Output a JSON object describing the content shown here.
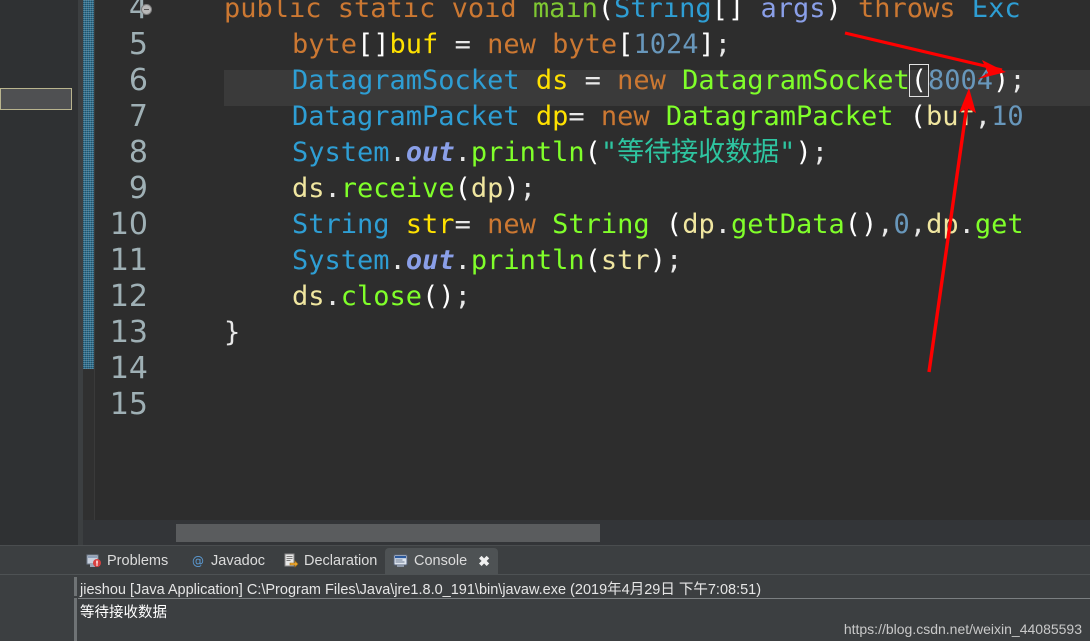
{
  "editor": {
    "active_line": 6,
    "line_numbers": [
      "4",
      "5",
      "6",
      "7",
      "8",
      "9",
      "10",
      "11",
      "12",
      "13",
      "14",
      "15"
    ],
    "code_lines": [
      {
        "number": "4",
        "text": "public static void main(String[] args) throws Exc"
      },
      {
        "number": "5",
        "text": "    byte[]buf = new byte[1024];"
      },
      {
        "number": "6",
        "text": "      DatagramSocket ds = new DatagramSocket(8004);"
      },
      {
        "number": "7",
        "text": "      DatagramPacket dp= new DatagramPacket (buf,10"
      },
      {
        "number": "8",
        "text": "      System.out.println(\"等待接收数据\");"
      },
      {
        "number": "9",
        "text": "    ds.receive(dp);"
      },
      {
        "number": "10",
        "text": "    String str= new String (dp.getData(),0,dp.get"
      },
      {
        "number": "11",
        "text": "    System.out.println(str);"
      },
      {
        "number": "12",
        "text": "    ds.close();"
      },
      {
        "number": "13",
        "text": "}"
      },
      {
        "number": "14",
        "text": ""
      },
      {
        "number": "15",
        "text": ""
      }
    ],
    "tokens": {
      "l4": [
        "public",
        "static",
        "void",
        "main",
        "(",
        "String",
        "[]",
        "args",
        ")",
        "throws",
        "Exc"
      ],
      "l5": [
        "byte",
        "[]",
        "buf",
        "=",
        "new",
        "byte",
        "[",
        "1024",
        "]",
        ";"
      ],
      "l6": [
        "DatagramSocket",
        "ds",
        "=",
        "new",
        "DatagramSocket",
        "(",
        "8004",
        ")",
        ";"
      ],
      "l7": [
        "DatagramPacket",
        "dp",
        "=",
        "new",
        "DatagramPacket",
        "(",
        "buf",
        ",",
        "10"
      ],
      "l8": [
        "System",
        ".",
        "out",
        ".",
        "println",
        "(",
        "\"等待接收数据\"",
        ")",
        ";"
      ],
      "l9": [
        "ds",
        ".",
        "receive",
        "(",
        "dp",
        ")",
        ";"
      ],
      "l10": [
        "String",
        "str",
        "=",
        "new",
        "String",
        "(",
        "dp",
        ".",
        "getData",
        "()",
        ",",
        "0",
        ",",
        "dp",
        ".",
        "get"
      ],
      "l11": [
        "System",
        ".",
        "out",
        ".",
        "println",
        "(",
        "str",
        ")",
        ";"
      ],
      "l12": [
        "ds",
        ".",
        "close",
        "()",
        ";"
      ],
      "l13": [
        "}"
      ]
    },
    "highlight_port": "8004",
    "colors": {
      "background": "#2d2d2d",
      "highlight_row": "#3a3a3a",
      "keyword": "#cc7832",
      "type": "#2e9ed4",
      "variable": "#ffe100",
      "method": "#8cd41c",
      "number": "#6897bb",
      "string": "#2ec4a0",
      "field_static": "#8a9fe8",
      "gutter_text": "#9fb0b5",
      "annotation_arrow": "#fe0000"
    }
  },
  "bottom_panel": {
    "tabs": [
      {
        "label": "Problems",
        "icon": "problems-icon",
        "active": false,
        "closable": false
      },
      {
        "label": "Javadoc",
        "icon": "javadoc-icon",
        "active": false,
        "closable": false
      },
      {
        "label": "Declaration",
        "icon": "declaration-icon",
        "active": false,
        "closable": false
      },
      {
        "label": "Console",
        "icon": "console-icon",
        "active": true,
        "closable": true
      }
    ],
    "close_glyph": "✖",
    "console": {
      "launch_line": "jieshou [Java Application] C:\\Program Files\\Java\\jre1.8.0_191\\bin\\javaw.exe (2019年4月29日 下午7:08:51)",
      "output": "等待接收数据"
    }
  },
  "watermark": {
    "text": "https://blog.csdn.net/weixin_44085593"
  }
}
